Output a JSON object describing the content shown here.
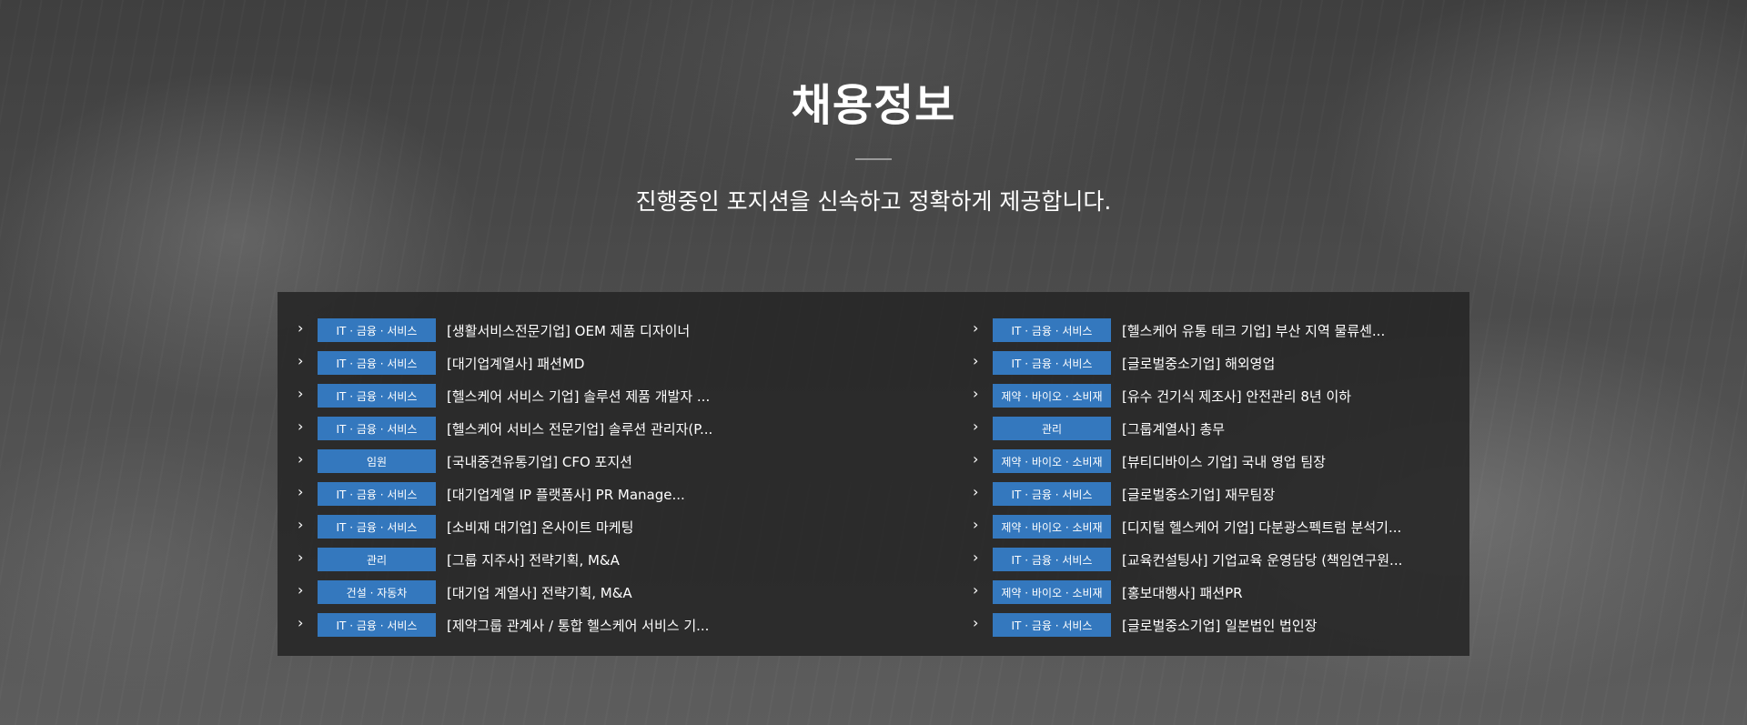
{
  "header": {
    "title": "채용정보",
    "subtitle": "진행중인 포지션을 신속하고 정확하게 제공합니다."
  },
  "icons": {
    "chevron": "chevron-right-icon"
  },
  "colors": {
    "badge": "#3478be",
    "panel": "#262626"
  },
  "jobs_left": [
    {
      "category": "IT · 금융 · 서비스",
      "title": "[생활서비스전문기업] OEM 제품 디자이너"
    },
    {
      "category": "IT · 금융 · 서비스",
      "title": "[대기업계열사] 패션MD"
    },
    {
      "category": "IT · 금융 · 서비스",
      "title": "[헬스케어 서비스 기업] 솔루션 제품 개발자 ..."
    },
    {
      "category": "IT · 금융 · 서비스",
      "title": "[헬스케어 서비스 전문기업] 솔루션 관리자(P..."
    },
    {
      "category": "임원",
      "title": "[국내중견유통기업] CFO 포지션"
    },
    {
      "category": "IT · 금융 · 서비스",
      "title": "[대기업계열 IP 플랫폼사] PR Manage..."
    },
    {
      "category": "IT · 금융 · 서비스",
      "title": "[소비재 대기업] 온사이트 마케팅"
    },
    {
      "category": "관리",
      "title": "[그룹 지주사] 전략기획, M&A"
    },
    {
      "category": "건설 · 자동차",
      "title": "[대기업 계열사] 전략기획, M&A"
    },
    {
      "category": "IT · 금융 · 서비스",
      "title": "[제약그룹 관계사 / 통합 헬스케어 서비스 기..."
    }
  ],
  "jobs_right": [
    {
      "category": "IT · 금융 · 서비스",
      "title": "[헬스케어 유통 테크 기업] 부산 지역 물류센..."
    },
    {
      "category": "IT · 금융 · 서비스",
      "title": "[글로벌중소기업] 해외영업"
    },
    {
      "category": "제약 · 바이오 · 소비재",
      "title": "[유수 건기식 제조사] 안전관리 8년 이하"
    },
    {
      "category": "관리",
      "title": "[그룹계열사] 총무"
    },
    {
      "category": "제약 · 바이오 · 소비재",
      "title": "[뷰티디바이스 기업] 국내 영업 팀장"
    },
    {
      "category": "IT · 금융 · 서비스",
      "title": "[글로벌중소기업] 재무팀장"
    },
    {
      "category": "제약 · 바이오 · 소비재",
      "title": "[디지털 헬스케어 기업] 다분광스펙트럼 분석기..."
    },
    {
      "category": "IT · 금융 · 서비스",
      "title": "[교육컨설팅사] 기업교육 운영담당 (책임연구원..."
    },
    {
      "category": "제약 · 바이오 · 소비재",
      "title": "[홍보대행사] 패션PR"
    },
    {
      "category": "IT · 금융 · 서비스",
      "title": "[글로벌중소기업] 일본법인 법인장"
    }
  ]
}
